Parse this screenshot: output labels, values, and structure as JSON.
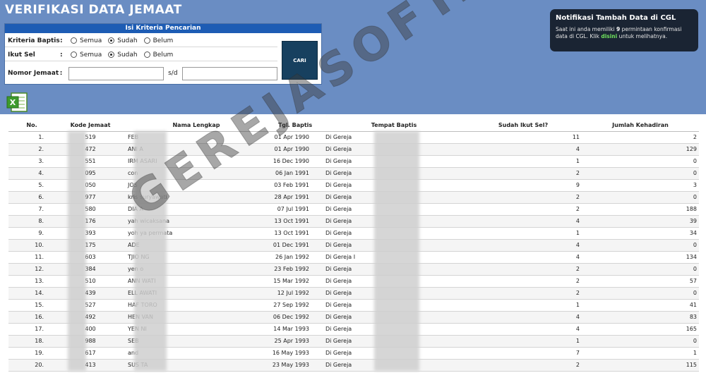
{
  "page": {
    "title": "VERIFIKASI DATA JEMAAT"
  },
  "search": {
    "header": "Isi Kriteria Pencarian",
    "baptis_label": "Kriteria Baptis",
    "sel_label": "Ikut Sel",
    "nomor_label": "Nomor Jemaat",
    "colon": ":",
    "opt_semua": "Semua",
    "opt_sudah": "Sudah",
    "opt_belum": "Belum",
    "sd_label": "s/d",
    "from_value": "",
    "to_value": "",
    "button_label": "CARI"
  },
  "notification": {
    "title": "Notifikasi Tambah Data di CGL",
    "text1": "Saat ini anda memiliki",
    "count": "9",
    "text2": "permintaan konfirmasi data di CGL. Klik",
    "link": "disini",
    "text3": "untuk melihatnya."
  },
  "watermark": "GEREJASOFT.COM",
  "table": {
    "headers": {
      "no": "No.",
      "kode": "Kode Jemaat",
      "nama": "Nama Lengkap",
      "tgl": "Tgl. Baptis",
      "tempat": "Tempat Baptis",
      "sel": "Sudah Ikut Sel?",
      "hadir": "Jumlah Kehadiran"
    },
    "rows": [
      {
        "no": "1.",
        "kode": "519",
        "nama": "FEB",
        "tgl": "01 Apr 1990",
        "tempat": "Di Gereja",
        "sel": "11",
        "hadir": "2"
      },
      {
        "no": "2.",
        "kode": "472",
        "nama": "ANI                 A",
        "tgl": "01 Apr 1990",
        "tempat": "Di Gereja",
        "sel": "4",
        "hadir": "129"
      },
      {
        "no": "3.",
        "kode": "551",
        "nama": "IRM              ASARI",
        "tgl": "16 Dec 1990",
        "tempat": "Di Gereja",
        "sel": "1",
        "hadir": "0"
      },
      {
        "no": "4.",
        "kode": "095",
        "nama": "con",
        "tgl": "06 Jan 1991",
        "tempat": "Di Gereja",
        "sel": "2",
        "hadir": "0"
      },
      {
        "no": "5.",
        "kode": "050",
        "nama": "JOS",
        "tgl": "03 Feb 1991",
        "tempat": "Di Gereja",
        "sel": "9",
        "hadir": "3"
      },
      {
        "no": "6.",
        "kode": "977",
        "nama": "kris                     suryawati",
        "tgl": "28 Apr 1991",
        "tempat": "Di Gereja",
        "sel": "2",
        "hadir": "0"
      },
      {
        "no": "7.",
        "kode": "580",
        "nama": "DIA                 A",
        "tgl": "07 Jul 1991",
        "tempat": "Di Gereja",
        "sel": "2",
        "hadir": "188"
      },
      {
        "no": "8.",
        "kode": "176",
        "nama": "yah                  wicaksana",
        "tgl": "13 Oct 1991",
        "tempat": "Di Gereja",
        "sel": "4",
        "hadir": "39"
      },
      {
        "no": "9.",
        "kode": "393",
        "nama": "yoh                  ya permata",
        "tgl": "13 Oct 1991",
        "tempat": "Di Gereja",
        "sel": "1",
        "hadir": "34"
      },
      {
        "no": "10.",
        "kode": "175",
        "nama": "ADE",
        "tgl": "01 Dec 1991",
        "tempat": "Di Gereja",
        "sel": "4",
        "hadir": "0"
      },
      {
        "no": "11.",
        "kode": "603",
        "nama": "TJIO               NG",
        "tgl": "26 Jan 1992",
        "tempat": "Di Gereja I",
        "sel": "4",
        "hadir": "134"
      },
      {
        "no": "12.",
        "kode": "384",
        "nama": "yen               o",
        "tgl": "23 Feb 1992",
        "tempat": "Di Gereja",
        "sel": "2",
        "hadir": "0"
      },
      {
        "no": "13.",
        "kode": "510",
        "nama": "ANN              WATI",
        "tgl": "15 Mar 1992",
        "tempat": "Di Gereja",
        "sel": "2",
        "hadir": "57"
      },
      {
        "no": "14.",
        "kode": "439",
        "nama": "ELL               AWATI",
        "tgl": "12 Jul 1992",
        "tempat": "Di Gereja",
        "sel": "2",
        "hadir": "0"
      },
      {
        "no": "15.",
        "kode": "527",
        "nama": "HAF             TORO",
        "tgl": "27 Sep 1992",
        "tempat": "Di Gereja",
        "sel": "1",
        "hadir": "41"
      },
      {
        "no": "16.",
        "kode": "492",
        "nama": "HEN             VAN",
        "tgl": "06 Dec 1992",
        "tempat": "Di Gereja",
        "sel": "4",
        "hadir": "83"
      },
      {
        "no": "17.",
        "kode": "400",
        "nama": "YEN              NI",
        "tgl": "14 Mar 1993",
        "tempat": "Di Gereja",
        "sel": "4",
        "hadir": "165"
      },
      {
        "no": "18.",
        "kode": "988",
        "nama": "SEB",
        "tgl": "25 Apr 1993",
        "tempat": "Di Gereja",
        "sel": "1",
        "hadir": "0"
      },
      {
        "no": "19.",
        "kode": "617",
        "nama": "and",
        "tgl": "16 May 1993",
        "tempat": "Di Gereja",
        "sel": "7",
        "hadir": "1"
      },
      {
        "no": "20.",
        "kode": "413",
        "nama": "SUS              TA",
        "tgl": "23 May 1993",
        "tempat": "Di Gereja",
        "sel": "2",
        "hadir": "115"
      }
    ]
  },
  "colors": {
    "header_blue": "#1d5cb4",
    "page_bg": "#6a8dc3",
    "cari_bg": "#17405f",
    "notif_bg": "#1a2433",
    "link_green": "#6fe05d"
  },
  "icons": {
    "export": "excel-icon"
  }
}
